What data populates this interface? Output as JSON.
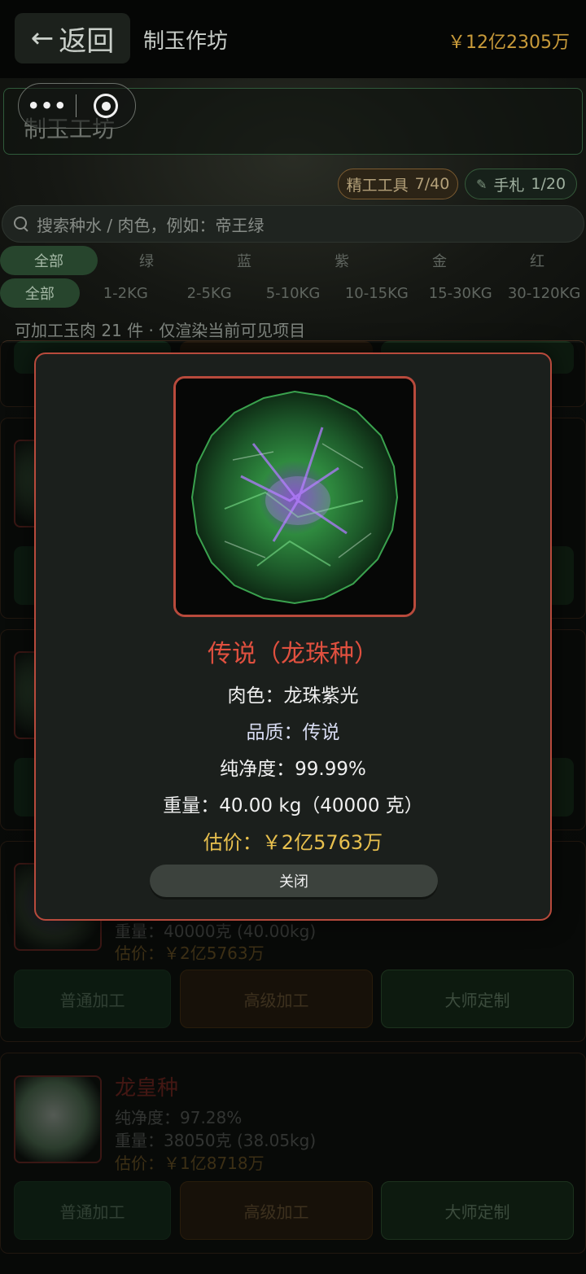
{
  "topbar": {
    "back_label": "返回",
    "title": "制玉作坊",
    "balance": "￥12亿2305万"
  },
  "capsule": {
    "more_icon": "more-dots-icon",
    "close_icon": "target-icon"
  },
  "workshop": {
    "title": "制玉工坊"
  },
  "chips": {
    "tools_label": "精工工具",
    "tools_count": "7/40",
    "notes_label": "手札",
    "notes_count": "1/20"
  },
  "search": {
    "placeholder": "搜索种水 / 肉色，例如：帝王绿"
  },
  "filters": {
    "colors": [
      "全部",
      "绿",
      "蓝",
      "紫",
      "金",
      "红"
    ],
    "weights": [
      "全部",
      "1-2KG",
      "2-5KG",
      "5-10KG",
      "10-15KG",
      "15-30KG",
      "30-120KG"
    ],
    "active_color": "全部",
    "active_weight": "全部"
  },
  "count_text": "可加工玉肉 21 件 · 仅渲染当前可见项目",
  "cards": [
    {
      "weight": "重量：40000克 (40.00kg)",
      "price": "估价：￥2亿5763万"
    },
    {
      "name": "龙皇种",
      "purity": "纯净度：97.28%",
      "weight": "重量：38050克 (38.05kg)",
      "price": "估价：￥1亿8718万"
    }
  ],
  "actions": {
    "normal": "普通加工",
    "advanced": "高级加工",
    "master": "大师定制"
  },
  "modal": {
    "title": "传说（龙珠种）",
    "flesh_label": "肉色：",
    "flesh_value": "龙珠紫光",
    "quality_label": "品质：",
    "quality_value": "传说",
    "purity": "纯净度：99.99%",
    "weight": "重量：40.00 kg（40000 克）",
    "price": "估价：￥2亿5763万",
    "close_label": "关闭"
  },
  "colors": {
    "accent_red": "#b84a3c",
    "title_red": "#e0503f",
    "price_gold": "#e8c04e",
    "jade_green": "#2f8a3f",
    "jade_purple": "#9a5ae0"
  }
}
